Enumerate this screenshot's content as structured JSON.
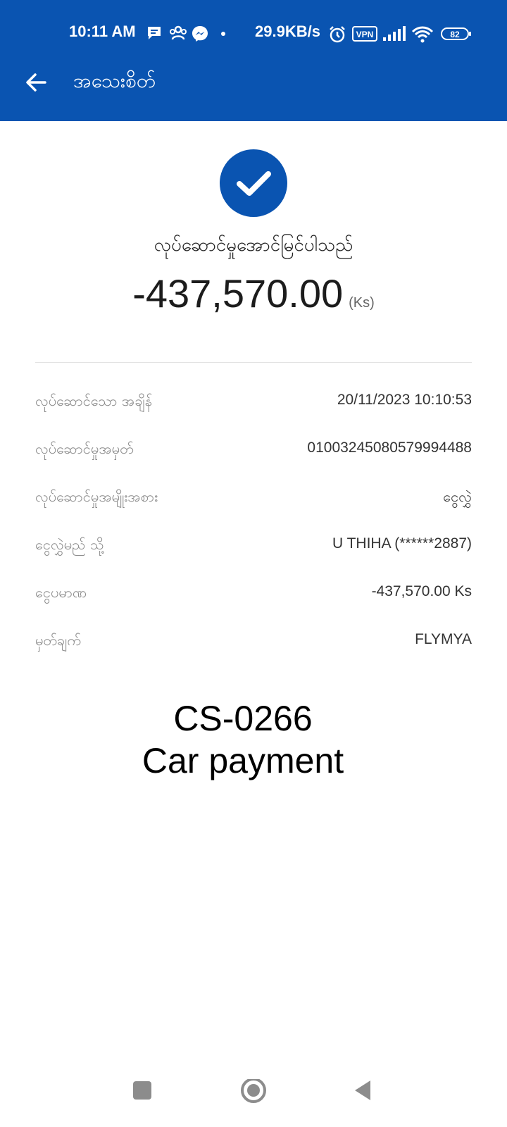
{
  "status_bar": {
    "time": "10:11 AM",
    "network_speed": "29.9KB/s",
    "vpn_label": "VPN",
    "battery": "82",
    "icons": [
      "message-icon",
      "people-icon",
      "messenger-icon",
      "dot-icon",
      "alarm-icon",
      "vpn-icon",
      "signal-icon",
      "wifi-icon",
      "battery-icon"
    ]
  },
  "header": {
    "title": "အသေးစိတ်",
    "back_icon": "back-arrow-icon"
  },
  "result": {
    "icon": "check-circle-icon",
    "message": "လုပ်ဆောင်မှုအောင်မြင်ပါသည်",
    "amount": "-437,570.00",
    "unit": "(Ks)"
  },
  "details": [
    {
      "label": "လုပ်ဆောင်သော အချိန်",
      "value": "20/11/2023 10:10:53"
    },
    {
      "label": "လုပ်ဆောင်မှုအမှတ်",
      "value": "01003245080579994488"
    },
    {
      "label": "လုပ်ဆောင်မှုအမျိုးအစား",
      "value": "ငွေလွှဲ"
    },
    {
      "label": "ငွေလွှဲမည် သို့",
      "value": "U THIHA (******2887)"
    },
    {
      "label": "ငွေပမာဏ",
      "value": "-437,570.00 Ks"
    },
    {
      "label": "မှတ်ချက်",
      "value": "FLYMYA"
    }
  ],
  "note": {
    "line1": "CS-0266",
    "line2": "Car payment"
  },
  "nav_bar": {
    "icons": [
      "recents-square-icon",
      "home-circle-icon",
      "back-triangle-icon"
    ]
  },
  "colors": {
    "header_bg": "#0a54b1",
    "accent": "#0a54b1"
  }
}
